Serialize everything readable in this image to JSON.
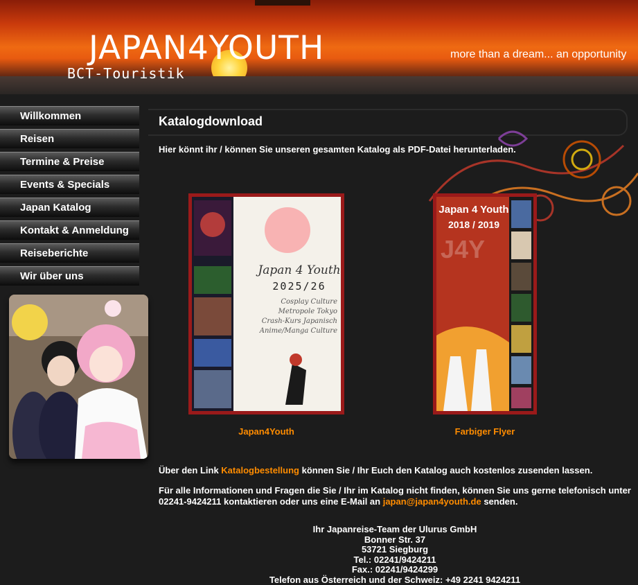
{
  "header": {
    "title": "JAPAN4YOUTH",
    "subtitle": "BCT-Touristik",
    "tagline": "more than a dream... an opportunity"
  },
  "nav": {
    "items": [
      {
        "label": "Willkommen"
      },
      {
        "label": "Reisen"
      },
      {
        "label": "Termine & Preise"
      },
      {
        "label": "Events & Specials"
      },
      {
        "label": "Japan Katalog"
      },
      {
        "label": "Kontakt & Anmeldung"
      },
      {
        "label": "Reiseberichte"
      },
      {
        "label": "Wir über uns"
      }
    ]
  },
  "content": {
    "title": "Katalogdownload",
    "intro": "Hier könnt ihr / können Sie unseren gesamten Katalog als PDF-Datei herunterladen.",
    "catalog1": {
      "caption": "Japan4Youth",
      "cover_title": "Japan 4 Youth",
      "cover_year": "2025/26",
      "cover_lines": [
        "Cosplay Culture",
        "Metropole Tokyo",
        "Crash-Kurs Japanisch",
        "Anime/Manga Culture"
      ]
    },
    "catalog2": {
      "caption": "Farbiger Flyer",
      "cover_title": "Japan 4 Youth",
      "cover_year": "2018 / 2019",
      "cover_watermark": "J4Y"
    },
    "order_text_before": "Über den Link ",
    "order_link": "Katalogbestellung",
    "order_text_after": " können Sie / Ihr Euch den Katalog auch kostenlos zusenden lassen.",
    "info_text": "Für alle Informationen und Fragen die Sie / Ihr im Katalog nicht finden, können Sie uns gerne telefonisch unter 02241-9424211 kontaktieren oder uns eine E-Mail an ",
    "email": "japan@japan4youth.de",
    "info_text_after": " senden.",
    "address": {
      "team": "Ihr Japanreise-Team der Ulurus GmbH",
      "street": "Bonner Str. 37",
      "city": "53721 Siegburg",
      "tel": "Tel.: 02241/9424211",
      "fax": "Fax.: 02241/9424299",
      "intl": "Telefon aus Österreich und der Schweiz: +49 2241 9424211"
    }
  },
  "colors": {
    "link": "#ff8c00",
    "background": "#1c1c1c",
    "cover_border": "#9a1a1a"
  }
}
